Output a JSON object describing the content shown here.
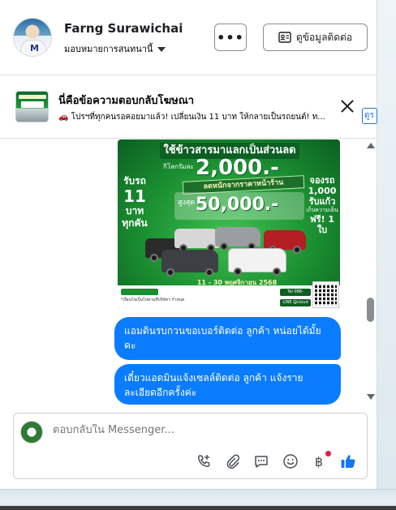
{
  "header": {
    "name": "Farng Surawichai",
    "assign_label": "มอบหมายการสนทนานี้",
    "more_label": "•••",
    "contact_label": "ดูข้อมูลติดต่อ"
  },
  "ad_reply": {
    "title": "นี่คือข้อความตอบกลับโฆษณา",
    "description": "🚗 โปรฯที่ทุกคนรอคอยมาแล้ว! เปลี่ยนเงิน 11 บาท ให้กลายเป็นรถยนต์! ท...",
    "see_label": "ดูร"
  },
  "ad_image": {
    "headline": "ใช้ข้าวสารมาแลกเป็นส่วนลด",
    "discount_value": "2,000.-",
    "discount_prefix": "กิโลกรัมละ",
    "banner": "ลดหนักจากราคาหน้าร้าน",
    "max_label": "สูงสุด",
    "max_value": "50,000.-",
    "left_line1": "รับรถ",
    "left_num": "11",
    "left_line2": "บาท",
    "left_line3": "ทุกคัน",
    "right_line1": "จองรถ",
    "right_num": "1,000",
    "right_line2": "รับแก้ว",
    "right_small": "เก็บความเย็น",
    "right_line3": "ฟรี! 1 ใบ",
    "date": "11 - 30 พฤศจิกายน 2568",
    "footer_note": "*เงื่อนไขเป็นไปตามที่บริษัทฯ กำหนด",
    "tel_label": "Tel 088-6577932",
    "line_label": "LINE @cloud"
  },
  "messages": [
    {
      "sender": "page",
      "text": "แอมดินรบกวนขอเบอร์ติดต่อ ลูกค้า  หน่อยได้มั้ยคะ"
    },
    {
      "sender": "page",
      "text": "เดี๋ยวแอดมินแจ้งเซลล์ติดต่อ ลูกค้า  แจ้งรายละเอียดอีกครั้งค่ะ"
    }
  ],
  "composer": {
    "placeholder": "ตอบกลับใน Messenger...",
    "tools": [
      "call-add-icon",
      "attachment-icon",
      "saved-reply-icon",
      "emoji-icon",
      "baht-payment-icon",
      "thumbs-up-icon"
    ],
    "baht_symbol": "฿"
  },
  "colors": {
    "bubble": "#0a7cff",
    "accent": "#1b74e4",
    "ad_green": "#1b8f31"
  }
}
